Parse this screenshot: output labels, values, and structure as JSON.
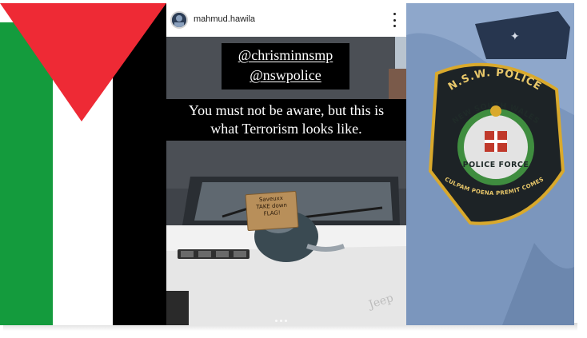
{
  "flag_panel": {
    "colors": {
      "black": "#000000",
      "white": "#ffffff",
      "green": "#149b3d",
      "red": "#ee2a35"
    }
  },
  "story": {
    "username": "mahmud.hawila",
    "mentions": [
      "@chrisminnsmp",
      "@nswpolice"
    ],
    "caption_lines": [
      "You must not be aware, but this is",
      "what Terrorism looks like."
    ],
    "sign_lines": [
      "Saveuxx",
      "TAKE down",
      "FLAG!"
    ],
    "icons": {
      "avatar": "profile-avatar",
      "more": "vertical-ellipsis-icon"
    },
    "progress_dots": 3
  },
  "patch_panel": {
    "title": "N.S.W. POLICE",
    "arc_text": "NEW SOUTH WALES",
    "inner_text": "POLICE FORCE",
    "bottom_text": "CULPAM POENA PREMIT COMES",
    "colors": {
      "badge": "#1d2326",
      "border": "#d9a92c",
      "shirt": "#7b96bd",
      "wreath": "#3f8d3f"
    }
  }
}
